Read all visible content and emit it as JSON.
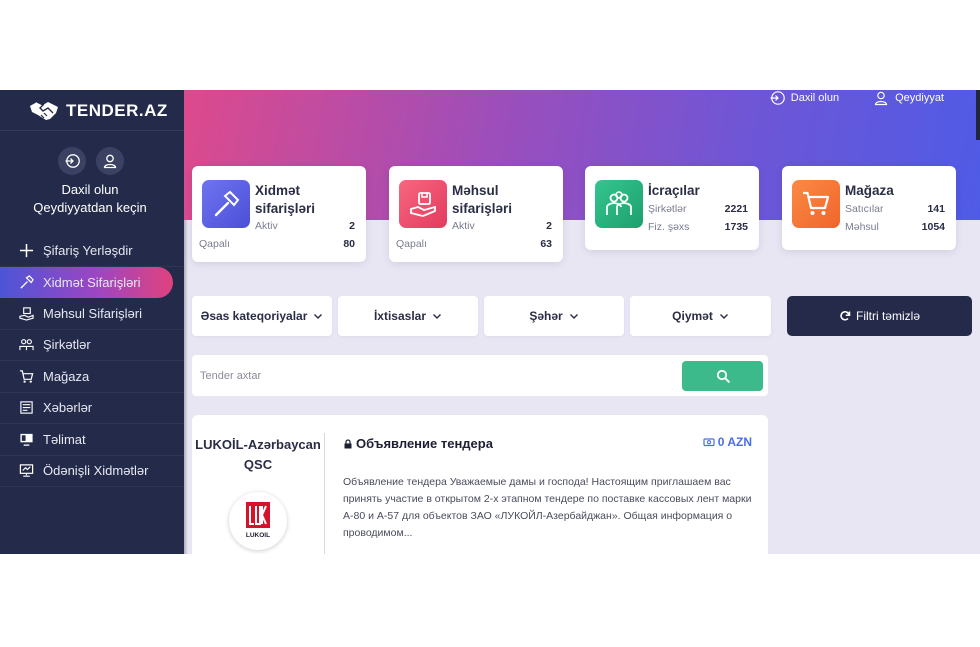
{
  "brand": {
    "name": "TENDER.AZ"
  },
  "auth": {
    "login": "Daxil olun",
    "register_prompt": "Qeydiyyatdan keçin"
  },
  "topbar": {
    "login": "Daxil olun",
    "register": "Qeydiyyat"
  },
  "nav": {
    "items": [
      {
        "label": "Şifariş Yerləşdir",
        "icon": "plus-icon"
      },
      {
        "label": "Xidmət Sifarişləri",
        "icon": "hammer-icon",
        "active": true
      },
      {
        "label": "Məhsul Sifarişləri",
        "icon": "hand-box-icon"
      },
      {
        "label": "Şirkətlər",
        "icon": "people-icon"
      },
      {
        "label": "Mağaza",
        "icon": "cart-icon"
      },
      {
        "label": "Xəbərlər",
        "icon": "newspaper-icon"
      },
      {
        "label": "Təlimat",
        "icon": "screen-icon"
      },
      {
        "label": "Ödənişli Xidmətlər",
        "icon": "monitor-icon"
      }
    ]
  },
  "cards": [
    {
      "title": "Xidmət sifarişləri",
      "rows": [
        {
          "label": "Aktiv",
          "value": "2"
        },
        {
          "label": "Qapalı",
          "value": "80"
        }
      ],
      "color": "#5b63e8"
    },
    {
      "title": "Məhsul sifarişləri",
      "rows": [
        {
          "label": "Aktiv",
          "value": "2"
        },
        {
          "label": "Qapalı",
          "value": "63"
        }
      ],
      "color": "#ee4a6e"
    },
    {
      "title": "İcraçılar",
      "rows": [
        {
          "label": "Şirkətlər",
          "value": "2221"
        },
        {
          "label": "Fiz. şəxs",
          "value": "1735"
        }
      ],
      "color": "#2fb380"
    },
    {
      "title": "Mağaza",
      "rows": [
        {
          "label": "Satıcılar",
          "value": "141"
        },
        {
          "label": "Məhsul",
          "value": "1054"
        }
      ],
      "color": "#f57a3a"
    }
  ],
  "filters": {
    "category": "Əsas kateqoriyalar",
    "specialty": "İxtisaslar",
    "city": "Şəhər",
    "price": "Qiymət",
    "clear": "Filtri təmizlə"
  },
  "search": {
    "placeholder": "Tender axtar"
  },
  "tender": {
    "company": "LUKOİL-Azərbaycan QSC",
    "logo_text": "LUKOIL",
    "title": "Объявление тендера",
    "price": "0 AZN",
    "description": "Объявление тендера Уважаемые дамы и господа! Настоящим приглашаем вас принять участие в открытом 2-х этапном тендере по поставке кассовых лент марки А-80 и А-57 для объектов ЗАО «ЛУКОЙЛ-Азербайджан». Общая информация о проводимом..."
  }
}
